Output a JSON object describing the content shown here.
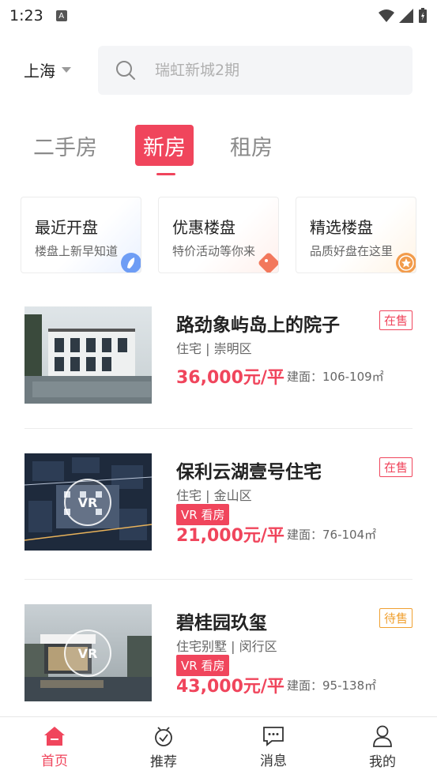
{
  "status_bar": {
    "time": "1:23"
  },
  "header": {
    "city": "上海",
    "search_placeholder": "瑞虹新城2期"
  },
  "tabs": [
    {
      "label": "二手房",
      "active": false
    },
    {
      "label": "新房",
      "active": true
    },
    {
      "label": "租房",
      "active": false
    }
  ],
  "quick_cards": [
    {
      "title": "最近开盘",
      "subtitle": "楼盘上新早知道",
      "icon": "rocket-icon",
      "color": "#5b8ff0"
    },
    {
      "title": "优惠楼盘",
      "subtitle": "特价活动等你来",
      "icon": "tag-icon",
      "color": "#f2785c"
    },
    {
      "title": "精选楼盘",
      "subtitle": "品质好盘在这里",
      "icon": "star-icon",
      "color": "#f29b4b"
    }
  ],
  "listings": [
    {
      "title": "路劲象屿岛上的院子",
      "status": "在售",
      "meta": "住宅 | 崇明区",
      "vr": false,
      "price": "36,000元/平",
      "area": "建面：106-109㎡"
    },
    {
      "title": "保利云湖壹号住宅",
      "status": "在售",
      "meta": "住宅 | 金山区",
      "vr": true,
      "vr_label": "VR 看房",
      "price": "21,000元/平",
      "area": "建面：76-104㎡"
    },
    {
      "title": "碧桂园玖玺",
      "status": "待售",
      "meta": "住宅别墅 | 闵行区",
      "vr": true,
      "vr_label": "VR 看房",
      "price": "43,000元/平",
      "area": "建面：95-138㎡"
    }
  ],
  "bottom_nav": [
    {
      "label": "首页",
      "icon": "home-icon",
      "active": true
    },
    {
      "label": "推荐",
      "icon": "recommend-icon",
      "active": false
    },
    {
      "label": "消息",
      "icon": "message-icon",
      "active": false
    },
    {
      "label": "我的",
      "icon": "profile-icon",
      "active": false
    }
  ],
  "colors": {
    "accent": "#f0455c",
    "pending": "#f0a030"
  }
}
